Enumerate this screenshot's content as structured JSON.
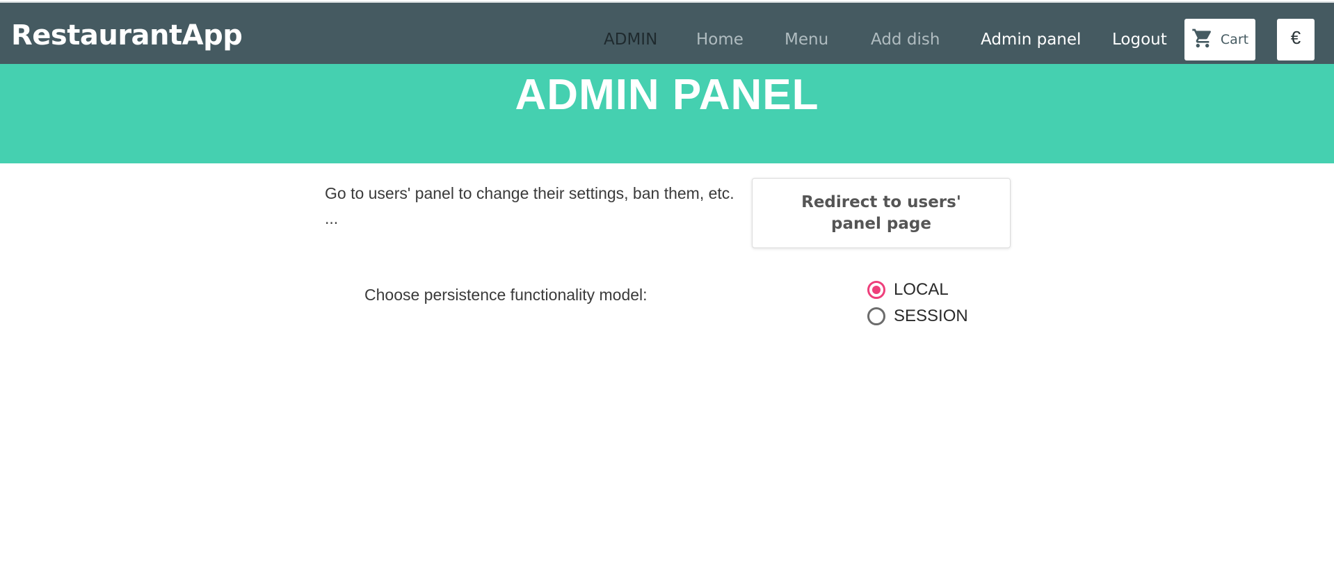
{
  "navbar": {
    "brand": "RestaurantApp",
    "role_tag": "ADMIN",
    "links": {
      "home": "Home",
      "menu": "Menu",
      "add_dish": "Add dish",
      "admin_panel": "Admin panel",
      "logout": "Logout"
    },
    "cart_label": "Cart",
    "cart_icon": "cart-icon",
    "currency_symbol": "€"
  },
  "hero": {
    "title": "ADMIN PANEL",
    "background_color": "#45d0b0"
  },
  "users_section": {
    "description": "Go to users' panel to change their settings, ban them, etc. ...",
    "button_label": "Redirect to users' panel page"
  },
  "persistence": {
    "label": "Choose persistence functionality model:",
    "options": [
      {
        "label": "LOCAL",
        "selected": true
      },
      {
        "label": "SESSION",
        "selected": false
      }
    ],
    "accent_color": "#ee3f7b"
  },
  "colors": {
    "navbar_bg": "#455a61",
    "active_link": "#ffffff",
    "inactive_link": "#b0bcc0"
  }
}
